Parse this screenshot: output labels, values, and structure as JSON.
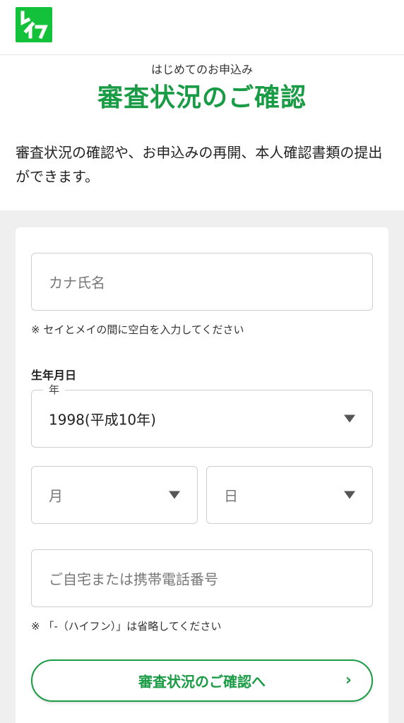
{
  "brand": {
    "name": "レイク",
    "logo_icon": "lake-logo",
    "color": "#13c13a"
  },
  "hero": {
    "subtitle": "はじめてのお申込み",
    "title": "審査状況のご確認",
    "description": "審査状況の確認や、お申込みの再開、本人確認書類の提出ができます。"
  },
  "form": {
    "name_field": {
      "placeholder": "カナ氏名",
      "value": ""
    },
    "name_note": "※ セイとメイの間に空白を入力してください",
    "birthdate_label": "生年月日",
    "year_select": {
      "legend": "年",
      "value": "1998(平成10年)"
    },
    "month_select": {
      "placeholder": "月"
    },
    "day_select": {
      "placeholder": "日"
    },
    "phone_field": {
      "placeholder": "ご自宅または携帯電話番号",
      "value": ""
    },
    "phone_note": "※ 「-（ハイフン）」は省略してください",
    "submit_label": "審査状況のご確認へ",
    "submit_icon": "chevron-right-icon"
  },
  "colors": {
    "accent": "#1a9b45",
    "background_gray": "#efefef",
    "border": "#cfcfcf"
  }
}
